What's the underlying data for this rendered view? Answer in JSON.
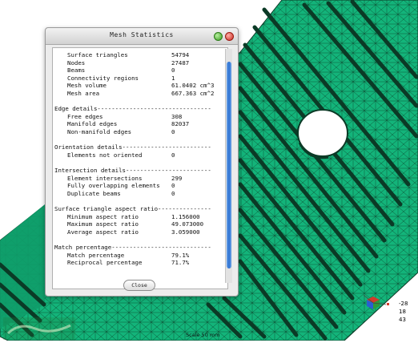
{
  "dialog": {
    "title": "Mesh Statistics",
    "close_label": "Close",
    "lines": [
      {
        "label": "Surface triangles",
        "value": "54794"
      },
      {
        "label": "Nodes",
        "value": "27487"
      },
      {
        "label": "Beams",
        "value": "0"
      },
      {
        "label": "Connectivity regions",
        "value": "1"
      },
      {
        "label": "Mesh volume",
        "value": "61.0402 cm^3"
      },
      {
        "label": "Mesh area",
        "value": "667.363 cm^2"
      },
      {
        "header": ""
      },
      {
        "header": "Edge details--------------------------------"
      },
      {
        "label": "Free edges",
        "value": "308"
      },
      {
        "label": "Manifold edges",
        "value": "82037"
      },
      {
        "label": "Non-manifold edges",
        "value": "0"
      },
      {
        "header": ""
      },
      {
        "header": "Orientation details-------------------------"
      },
      {
        "label": "Elements not oriented",
        "value": "0"
      },
      {
        "header": ""
      },
      {
        "header": "Intersection details------------------------"
      },
      {
        "label": "Element intersections",
        "value": "299"
      },
      {
        "label": "Fully overlapping elements",
        "value": "0"
      },
      {
        "label": "Duplicate beams",
        "value": "0"
      },
      {
        "header": ""
      },
      {
        "header": "Surface triangle aspect ratio---------------"
      },
      {
        "label": "Minimum aspect ratio",
        "value": "1.156000"
      },
      {
        "label": "Maximum aspect ratio",
        "value": "49.073000"
      },
      {
        "label": "Average aspect ratio",
        "value": "3.059000"
      },
      {
        "header": ""
      },
      {
        "header": "Match percentage----------------------------"
      },
      {
        "label": "Match percentage",
        "value": "79.1%"
      },
      {
        "label": "Reciprocal percentage",
        "value": "71.7%"
      }
    ]
  },
  "viewport": {
    "mesh_color": "#13b47a",
    "line_color": "#0b3a26",
    "coords": [
      "-28",
      "18",
      "43"
    ],
    "bottom_label": "Scale 50 mm"
  },
  "triad_icon": "xyz-axis-triad-icon"
}
